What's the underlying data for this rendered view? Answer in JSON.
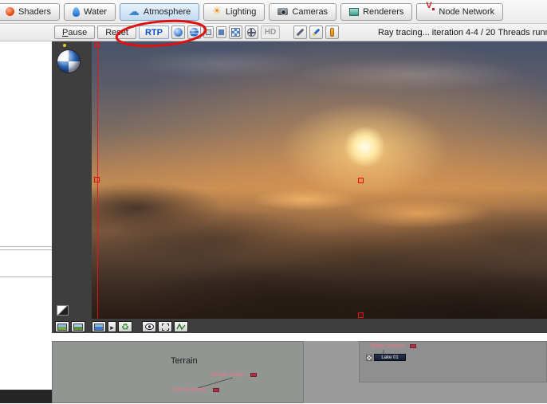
{
  "tabbar": {
    "tabs": [
      {
        "label": "Shaders"
      },
      {
        "label": "Water"
      },
      {
        "label": "Atmosphere"
      },
      {
        "label": "Lighting"
      },
      {
        "label": "Cameras"
      },
      {
        "label": "Renderers"
      },
      {
        "label": "Node Network"
      }
    ]
  },
  "toolbar": {
    "pause": "Pause",
    "reset": "Reset",
    "rtp": "RTP",
    "hd": "HD",
    "status": "Ray tracing... iteration 4-4 / 20",
    "threads": "Threads running"
  },
  "node_network": {
    "terrain_group": "Terrain",
    "simple_shape": "Simple shape...",
    "fractal_terrain": "Fractal terrain...",
    "water_shader": "Water shader...",
    "lake": "Lake 01"
  },
  "colors": {
    "annotation_red": "#dd1111",
    "rtp_blue": "#0a50c8",
    "node_text_pink": "#ee7788",
    "panel_dark": "#3e3e3e"
  }
}
